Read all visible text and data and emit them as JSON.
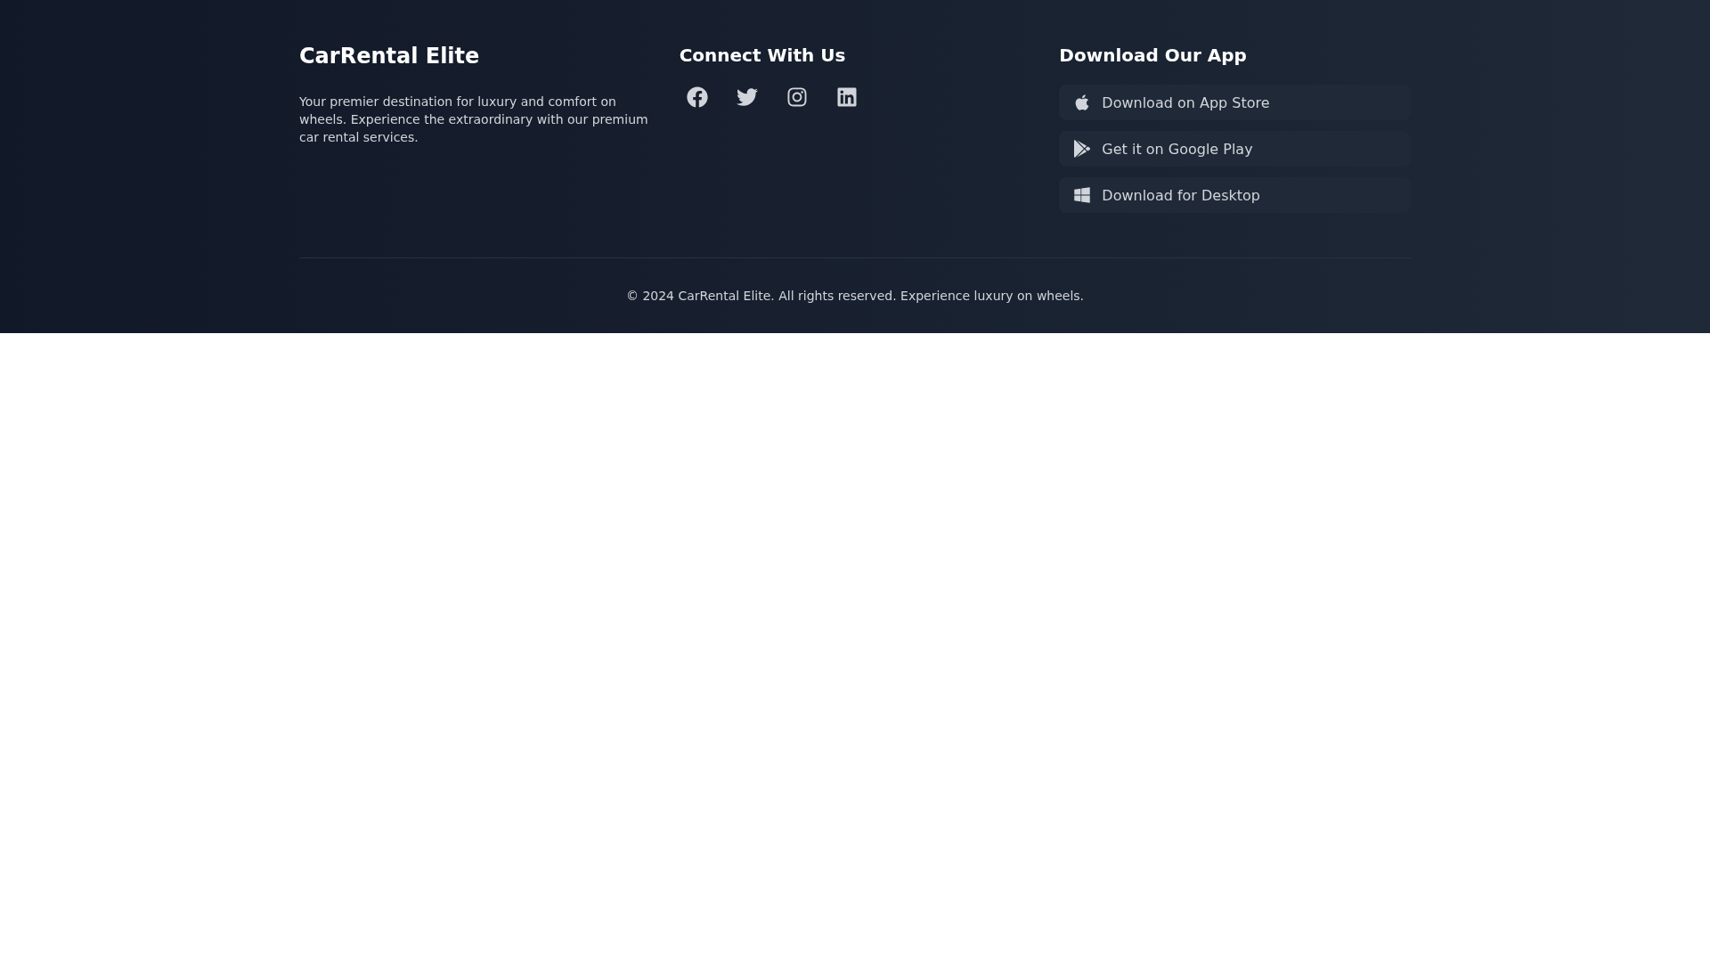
{
  "brand": {
    "title": "CarRental Elite",
    "description": "Your premier destination for luxury and comfort on wheels. Experience the extraordinary with our premium car rental services."
  },
  "social": {
    "heading": "Connect With Us",
    "links": [
      {
        "kind": "facebook"
      },
      {
        "kind": "twitter"
      },
      {
        "kind": "instagram"
      },
      {
        "kind": "linkedin"
      }
    ]
  },
  "download": {
    "heading": "Download Our App",
    "buttons": [
      {
        "kind": "apple",
        "label": "Download on App Store"
      },
      {
        "kind": "play",
        "label": "Get it on Google Play"
      },
      {
        "kind": "windows",
        "label": "Download for Desktop"
      }
    ]
  },
  "copyright": "© 2024 CarRental Elite. All rights reserved. Experience luxury on wheels."
}
